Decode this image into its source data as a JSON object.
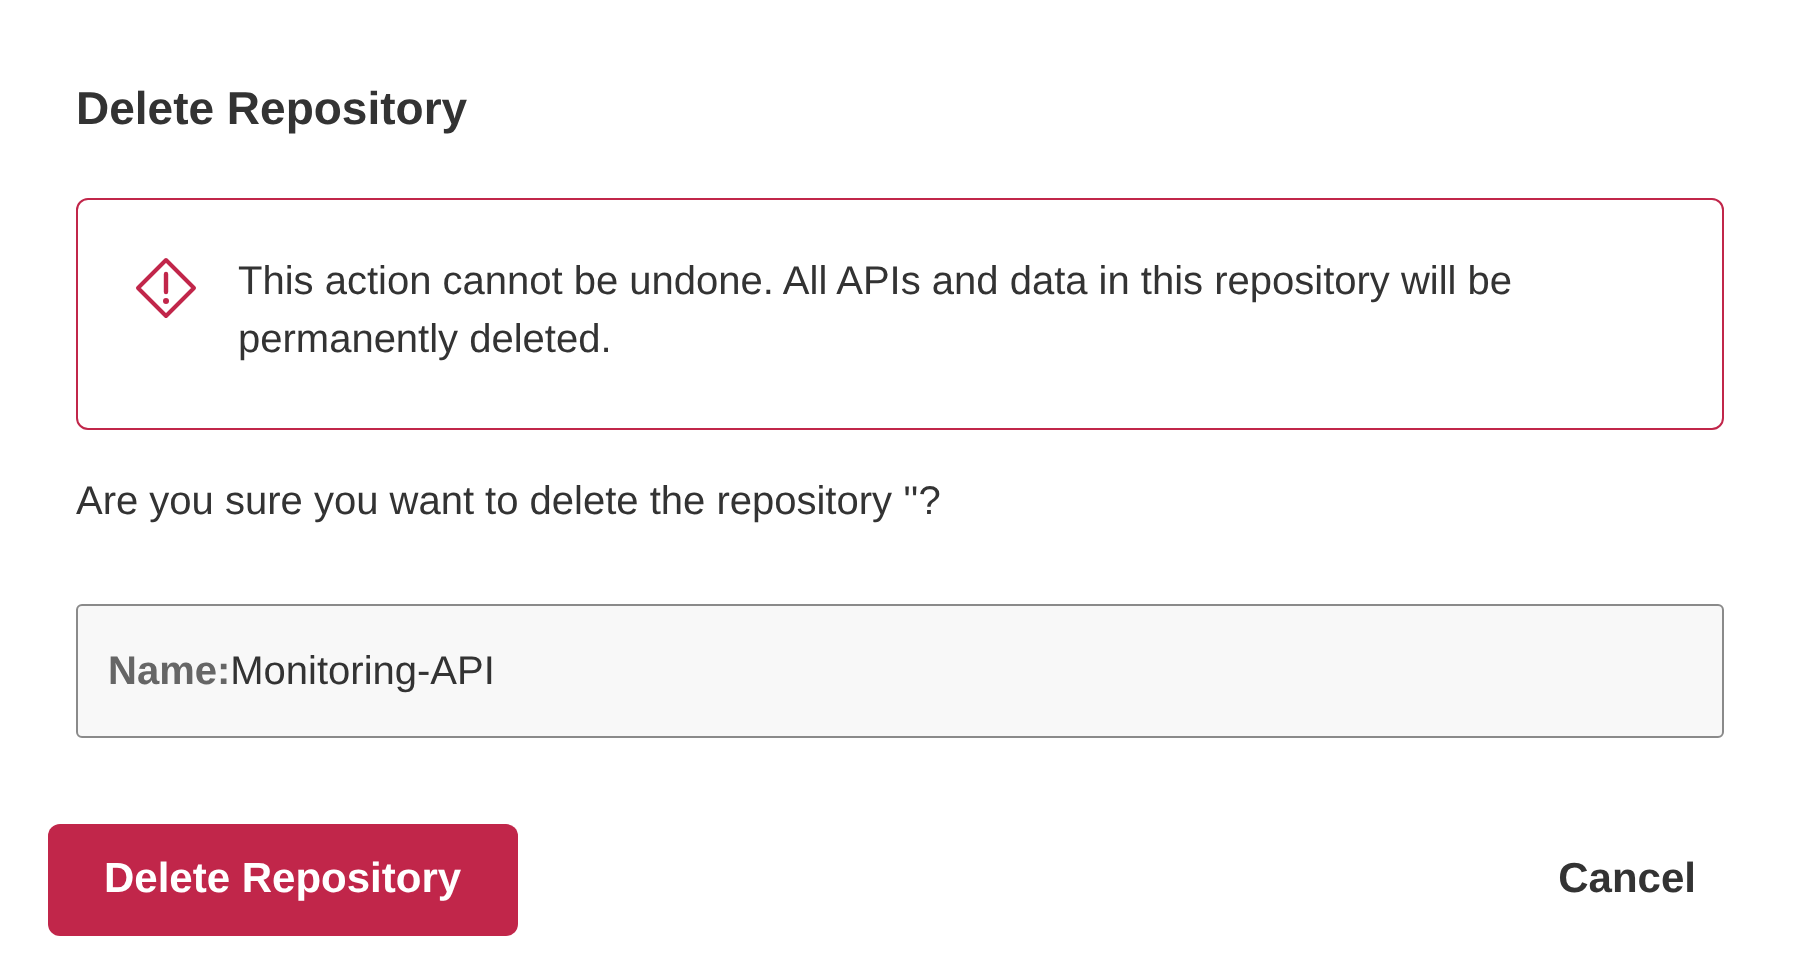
{
  "dialog": {
    "title": "Delete Repository",
    "warning": {
      "message": "This action cannot be undone. All APIs and data in this repository will be permanently deleted."
    },
    "question": "Are you sure you want to delete the repository ''?",
    "name_field": {
      "label": "Name:",
      "value": "Monitoring-API"
    },
    "buttons": [
      {
        "kind": "primary",
        "label": "Delete Repository"
      },
      {
        "kind": "secondary",
        "label": "Cancel"
      }
    ]
  }
}
